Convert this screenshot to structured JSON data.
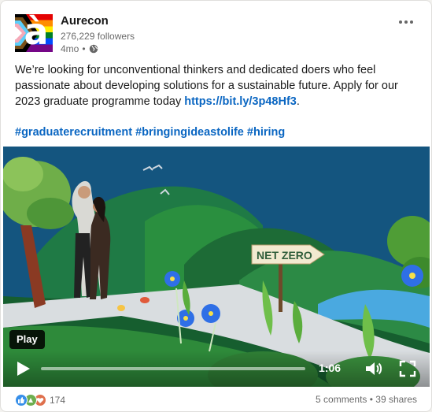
{
  "post": {
    "company": "Aurecon",
    "logo_letter": "à",
    "followers": "276,229 followers",
    "age": "4mo",
    "age_sep": "•",
    "text": "We’re looking for unconventional thinkers and dedicated doers who feel passionate about developing solutions for a sustainable future. Apply for our 2023 graduate programme today ",
    "link": "https://bit.ly/3p48Hf3",
    "link_suffix": ".",
    "hashtags": [
      "#graduaterecruitment",
      "#bringingideastolife",
      "#hiring"
    ]
  },
  "video": {
    "sign_text": "NET ZERO",
    "play_tooltip": "Play",
    "time": "1:06",
    "progress": 0.0
  },
  "social": {
    "reactions": [
      "like",
      "celebrate",
      "love"
    ],
    "reaction_count": "174",
    "comments": "5 comments",
    "separator": "•",
    "shares": "39 shares"
  },
  "icons": {
    "more": "more-options-icon",
    "globe": "globe-icon",
    "play": "play-icon",
    "volume": "volume-icon",
    "fullscreen": "fullscreen-icon"
  },
  "colors": {
    "link": "#0a66c2",
    "like": "#378fe9",
    "celebrate": "#6dae4f",
    "love": "#df704d"
  }
}
